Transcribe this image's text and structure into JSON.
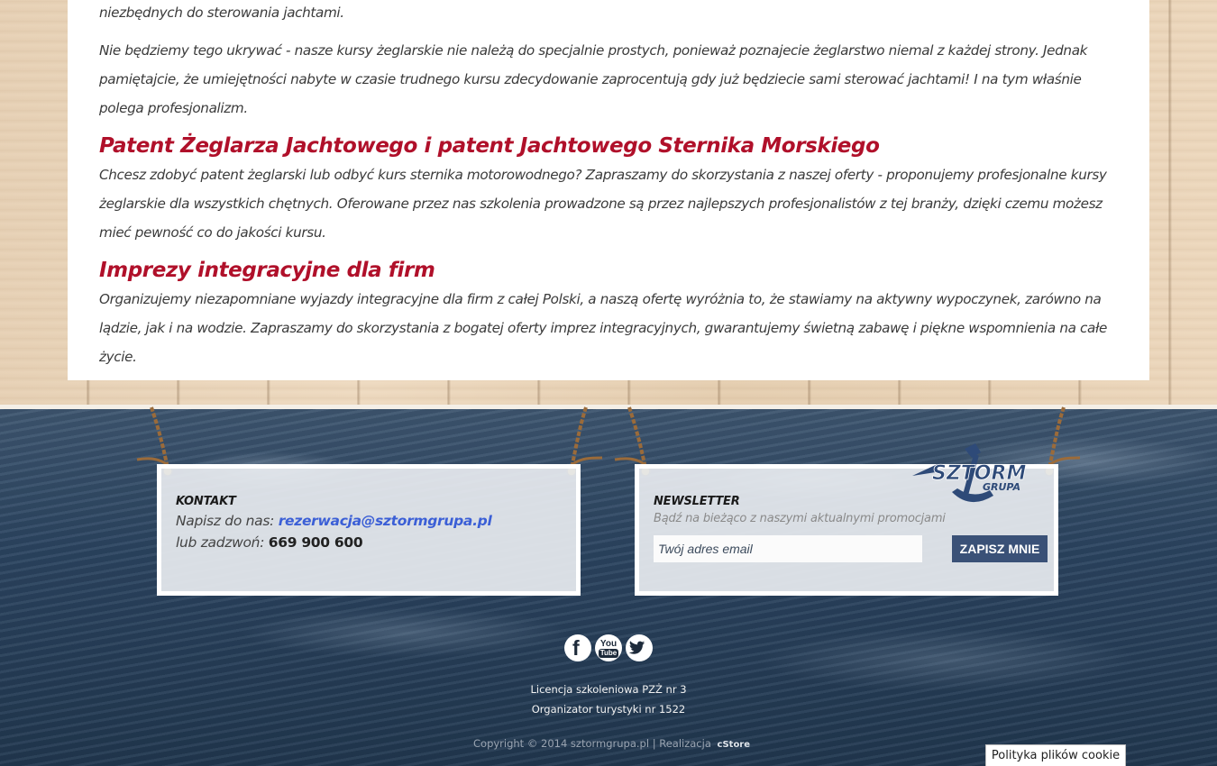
{
  "main": {
    "paragraph_top": "niezbędnych do sterowania jachtami.",
    "paragraph_1": "Nie będziemy tego ukrywać - nasze kursy żeglarskie nie należą do specjalnie prostych, ponieważ poznajecie żeglarstwo niemal z każdej strony. Jednak pamiętajcie, że umiejętności nabyte w czasie trudnego kursu zdecydowanie zaprocentują gdy już będziecie sami sterować jachtami! I na tym właśnie polega profesjonalizm.",
    "heading_2": "Patent Żeglarza Jachtowego i patent Jachtowego Sternika Morskiego",
    "paragraph_2": "Chcesz zdobyć patent żeglarski lub odbyć kurs sternika motorowodnego? Zapraszamy do skorzystania z naszej oferty - proponujemy profesjonalne kursy żeglarskie dla wszystkich chętnych. Oferowane przez nas szkolenia prowadzone są przez najlepszych profesjonalistów z tej branży, dzięki czemu możesz mieć pewność co do jakości kursu.",
    "heading_3": "Imprezy integracyjne dla firm",
    "paragraph_3": "Organizujemy niezapomniane wyjazdy integracyjne dla firm z całej Polski, a naszą ofertę wyróżnia to, że stawiamy na aktywny wypoczynek, zarówno na lądzie, jak i na wodzie. Zapraszamy do skorzystania z bogatej oferty imprez integracyjnych, gwarantujemy świetną zabawę i piękne wspomnienia na całe życie."
  },
  "contact": {
    "title": "KONTAKT",
    "write_label": "Napisz do nas:",
    "email": "rezerwacja@sztormgrupa.pl",
    "call_label": "lub zadzwoń:",
    "phone": "669 900 600"
  },
  "newsletter": {
    "title": "NEWSLETTER",
    "subtitle": "Bądź na bieżąco z naszymi aktualnymi promocjami",
    "placeholder": "Twój adres email",
    "button": "ZAPISZ MNIE"
  },
  "logo": {
    "line1": "SZTORM",
    "line2": "GRUPA"
  },
  "social": {
    "facebook_glyph": "f",
    "youtube_glyph_top": "You",
    "youtube_glyph_bottom": "Tube",
    "twitter_icon": "twitter-bird"
  },
  "footer": {
    "license": "Licencja szkoleniowa PZŻ nr 3",
    "organizer": "Organizator turystyki nr 1522",
    "copyright": "Copyright © 2014 sztormgrupa.pl | Realizacja",
    "realization_brand": "cStore"
  },
  "cookie": {
    "label": "Polityka plików cookie"
  },
  "colors": {
    "heading": "#b0102a",
    "link": "#3b5fd6",
    "button": "#3a5177",
    "logo": "#2e4a78"
  }
}
